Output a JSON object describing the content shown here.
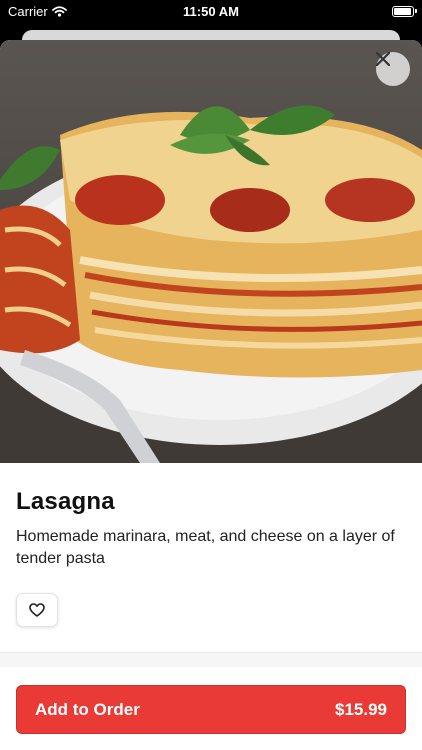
{
  "status_bar": {
    "carrier": "Carrier",
    "time": "11:50 AM",
    "battery_level": 1.0
  },
  "item": {
    "title": "Lasagna",
    "description": "Homemade marinara, meat, and cheese on a layer of tender pasta"
  },
  "icons": {
    "close": "close-icon",
    "favorite": "heart-outline-icon",
    "wifi": "wifi-icon",
    "battery": "battery-icon"
  },
  "order_button": {
    "label": "Add to Order",
    "price": "$15.99"
  },
  "colors": {
    "accent": "#e93a35",
    "text": "#111111"
  }
}
